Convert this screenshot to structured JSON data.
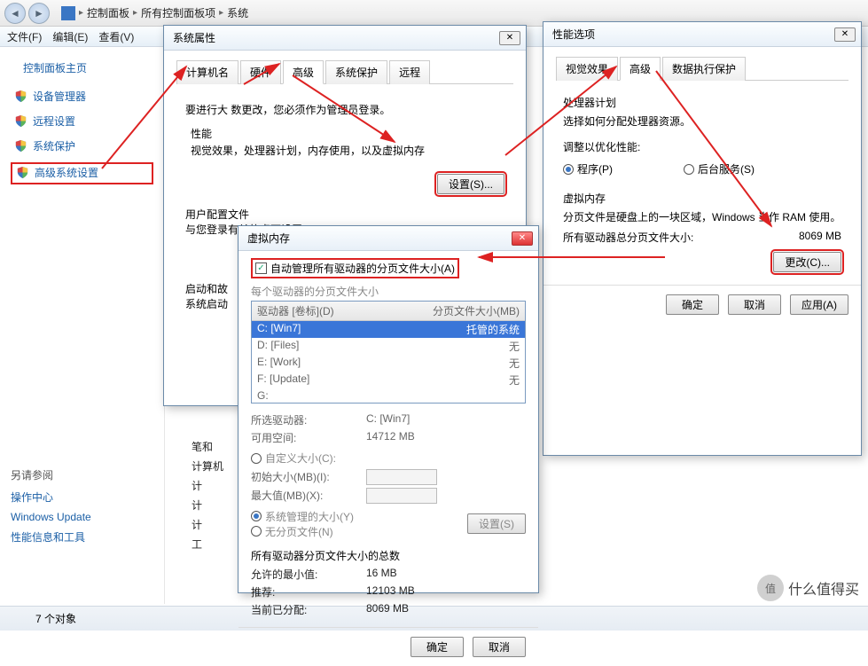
{
  "explorer": {
    "breadcrumb": [
      "控制面板",
      "所有控制面板项",
      "系统"
    ],
    "menubar": [
      "文件(F)",
      "编辑(E)",
      "查看(V)"
    ],
    "sidebar": {
      "title": "控制面板主页",
      "items": [
        {
          "label": "设备管理器",
          "shield": true
        },
        {
          "label": "远程设置",
          "shield": true
        },
        {
          "label": "系统保护",
          "shield": true
        },
        {
          "label": "高级系统设置",
          "shield": true,
          "boxed": true
        }
      ],
      "also_label": "另请参阅",
      "links": [
        "操作中心",
        "Windows Update",
        "性能信息和工具"
      ]
    },
    "main": {
      "lines": [
        "笔和",
        "计算机",
        "计",
        "计",
        "计",
        "工"
      ]
    },
    "status": "7 个对象"
  },
  "sys_props": {
    "title": "系统属性",
    "tabs": [
      "计算机名",
      "硬件",
      "高级",
      "系统保护",
      "远程"
    ],
    "active_tab": 2,
    "admin_note": "要进行大    数更改，您必须作为管理员登录。",
    "perf": {
      "title": "性能",
      "desc": "视觉效果，处理器计划，内存使用，以及虚拟内存",
      "btn": "设置(S)..."
    },
    "profile": {
      "title": "用户配置文件",
      "desc": "与您登录有关的桌面设置"
    },
    "startup": {
      "title": "启动和故",
      "desc": "系统启动"
    }
  },
  "perf_opts": {
    "title": "性能选项",
    "tabs": [
      "视觉效果",
      "高级",
      "数据执行保护"
    ],
    "active_tab": 1,
    "sched": {
      "title": "处理器计划",
      "desc": "选择如何分配处理器资源。",
      "adjust": "调整以优化性能:",
      "opt_program": "程序(P)",
      "opt_bg": "后台服务(S)"
    },
    "vmem": {
      "title": "虚拟内存",
      "desc": "分页文件是硬盘上的一块区域，Windows 当作 RAM 使用。",
      "total_label": "所有驱动器总分页文件大小:",
      "total_value": "8069 MB",
      "btn": "更改(C)..."
    },
    "footer": {
      "ok": "确定",
      "cancel": "取消",
      "apply": "应用(A)"
    }
  },
  "vmem_dlg": {
    "title": "虚拟内存",
    "auto_label": "自动管理所有驱动器的分页文件大小(A)",
    "each_label": "每个驱动器的分页文件大小",
    "col_drive": "驱动器 [卷标](D)",
    "col_size": "分页文件大小(MB)",
    "drives": [
      {
        "d": "C:",
        "label": "[Win7]",
        "size": "托管的系统",
        "sel": true
      },
      {
        "d": "D:",
        "label": "[Files]",
        "size": "无"
      },
      {
        "d": "E:",
        "label": "[Work]",
        "size": "无"
      },
      {
        "d": "F:",
        "label": "[Update]",
        "size": "无"
      },
      {
        "d": "G:",
        "label": "",
        "size": ""
      }
    ],
    "selected_drive_label": "所选驱动器:",
    "selected_drive_value": "C: [Win7]",
    "avail_label": "可用空间:",
    "avail_value": "14712 MB",
    "custom": "自定义大小(C):",
    "init_label": "初始大小(MB)(I):",
    "max_label": "最大值(MB)(X):",
    "sys_managed": "系统管理的大小(Y)",
    "no_page": "无分页文件(N)",
    "set_btn": "设置(S)",
    "totals_title": "所有驱动器分页文件大小的总数",
    "min_label": "允许的最小值:",
    "min_value": "16 MB",
    "rec_label": "推荐:",
    "rec_value": "12103 MB",
    "cur_label": "当前已分配:",
    "cur_value": "8069 MB",
    "ok": "确定",
    "cancel": "取消"
  },
  "watermark": "什么值得买"
}
